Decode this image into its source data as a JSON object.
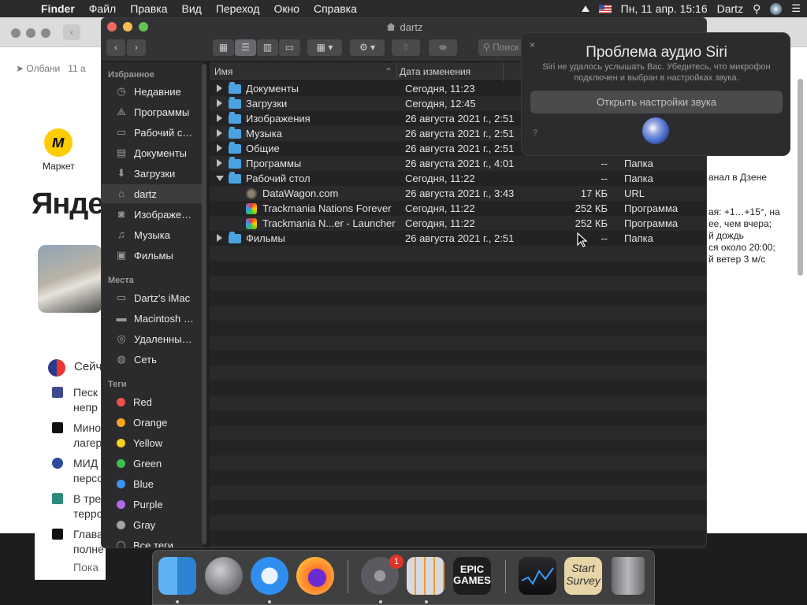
{
  "menubar": {
    "app": "Finder",
    "menus": [
      "Файл",
      "Правка",
      "Вид",
      "Переход",
      "Окно",
      "Справка"
    ],
    "datetime": "Пн, 11 апр.  15:16",
    "user": "Dartz"
  },
  "browser": {
    "geo": "Олбани",
    "geo_date": "11 а",
    "market_label": "Маркет",
    "market_logo": "м",
    "yandex_word": "Янде",
    "news_header": "Сейч",
    "news": [
      "Песк",
      "непр",
      "Мино",
      "лагер",
      "МИД",
      "персо",
      "В тре",
      "терро",
      "Глава",
      "полне",
      "Пока"
    ],
    "right_card": "анал в Дзене",
    "weather": [
      "ая: +1…+15°, на",
      "ее, чем вчера;",
      "й дождь",
      "ся около 20:00;",
      "й ветер 3 м/с"
    ]
  },
  "finder": {
    "title": "dartz",
    "search_placeholder": "Поиск",
    "sidebar": {
      "favorites_header": "Избранное",
      "favorites": [
        {
          "label": "Недавние",
          "icon": "clock-icon"
        },
        {
          "label": "Программы",
          "icon": "apps-icon"
        },
        {
          "label": "Рабочий стол",
          "icon": "desktop-icon"
        },
        {
          "label": "Документы",
          "icon": "document-icon"
        },
        {
          "label": "Загрузки",
          "icon": "download-icon"
        },
        {
          "label": "dartz",
          "icon": "home-icon"
        },
        {
          "label": "Изображения",
          "icon": "camera-icon"
        },
        {
          "label": "Музыка",
          "icon": "music-icon"
        },
        {
          "label": "Фильмы",
          "icon": "film-icon"
        }
      ],
      "places_header": "Места",
      "places": [
        {
          "label": "Dartz's iMac",
          "icon": "imac-icon"
        },
        {
          "label": "Macintosh HD",
          "icon": "disk-icon"
        },
        {
          "label": "Удаленный диск",
          "icon": "optical-disc-icon"
        },
        {
          "label": "Сеть",
          "icon": "network-icon"
        }
      ],
      "tags_header": "Теги",
      "tags": [
        {
          "label": "Red",
          "color": "#f0514a"
        },
        {
          "label": "Orange",
          "color": "#f5a623"
        },
        {
          "label": "Yellow",
          "color": "#f7d21e"
        },
        {
          "label": "Green",
          "color": "#3ec14c"
        },
        {
          "label": "Blue",
          "color": "#3a95f0"
        },
        {
          "label": "Purple",
          "color": "#b26ae8"
        },
        {
          "label": "Gray",
          "color": "#a3a3a3"
        },
        {
          "label": "Все теги…",
          "color": ""
        }
      ]
    },
    "columns": {
      "name": "Имя",
      "date": "Дата изменения",
      "size": "",
      "kind": ""
    },
    "rows": [
      {
        "name": "Документы",
        "date": "Сегодня, 11:23",
        "size": "",
        "kind": "",
        "type": "folder",
        "disclosure": "closed"
      },
      {
        "name": "Загрузки",
        "date": "Сегодня, 12:45",
        "size": "",
        "kind": "",
        "type": "folder",
        "disclosure": "closed"
      },
      {
        "name": "Изображения",
        "date": "26 августа 2021 г., 2:51",
        "size": "",
        "kind": "",
        "type": "folder",
        "disclosure": "closed"
      },
      {
        "name": "Музыка",
        "date": "26 августа 2021 г., 2:51",
        "size": "",
        "kind": "",
        "type": "folder",
        "disclosure": "closed"
      },
      {
        "name": "Общие",
        "date": "26 августа 2021 г., 2:51",
        "size": "",
        "kind": "",
        "type": "folder",
        "disclosure": "closed"
      },
      {
        "name": "Программы",
        "date": "26 августа 2021 г., 4:01",
        "size": "--",
        "kind": "Папка",
        "type": "folder",
        "disclosure": "closed"
      },
      {
        "name": "Рабочий стол",
        "date": "Сегодня, 11:22",
        "size": "--",
        "kind": "Папка",
        "type": "folder",
        "disclosure": "open"
      },
      {
        "name": "DataWagon.com",
        "date": "26 августа 2021 г., 3:43",
        "size": "17 КБ",
        "kind": "URL",
        "type": "url",
        "disclosure": ""
      },
      {
        "name": "Trackmania Nations Forever",
        "date": "Сегодня, 11:22",
        "size": "252 КБ",
        "kind": "Программа",
        "type": "app",
        "disclosure": ""
      },
      {
        "name": "Trackmania N...er - Launcher",
        "date": "Сегодня, 11:22",
        "size": "252 КБ",
        "kind": "Программа",
        "type": "app",
        "disclosure": ""
      },
      {
        "name": "Фильмы",
        "date": "26 августа 2021 г., 2:51",
        "size": "--",
        "kind": "Папка",
        "type": "folder",
        "disclosure": "closed"
      }
    ]
  },
  "siri": {
    "title": "Проблема аудио Siri",
    "message": "Siri не удалось услышать Вас. Убедитесь, что микрофон подключен и выбран в настройках звука.",
    "button": "Открыть настройки звука",
    "help": "?",
    "close": "×"
  },
  "dock": {
    "apps": [
      {
        "name": "Finder",
        "icon": "finder-icon",
        "running": true
      },
      {
        "name": "Launchpad",
        "icon": "launchpad-icon",
        "running": false
      },
      {
        "name": "Safari",
        "icon": "safari-icon",
        "running": true
      },
      {
        "name": "Firefox",
        "icon": "firefox-icon",
        "running": false
      },
      {
        "name": "System Preferences",
        "icon": "system-preferences-icon",
        "running": true,
        "badge": "1"
      },
      {
        "name": "Calculator",
        "icon": "calculator-icon",
        "running": true
      },
      {
        "name": "Epic Games",
        "icon": "epic-games-icon",
        "running": false,
        "text": "EPIC\nGAMES"
      },
      {
        "name": "Stocks",
        "icon": "stocks-icon",
        "running": false
      },
      {
        "name": "Start Survey",
        "icon": "survey-icon",
        "running": false,
        "text": "Start\nSurvey"
      },
      {
        "name": "Trash",
        "icon": "trash-icon",
        "running": false
      }
    ]
  }
}
